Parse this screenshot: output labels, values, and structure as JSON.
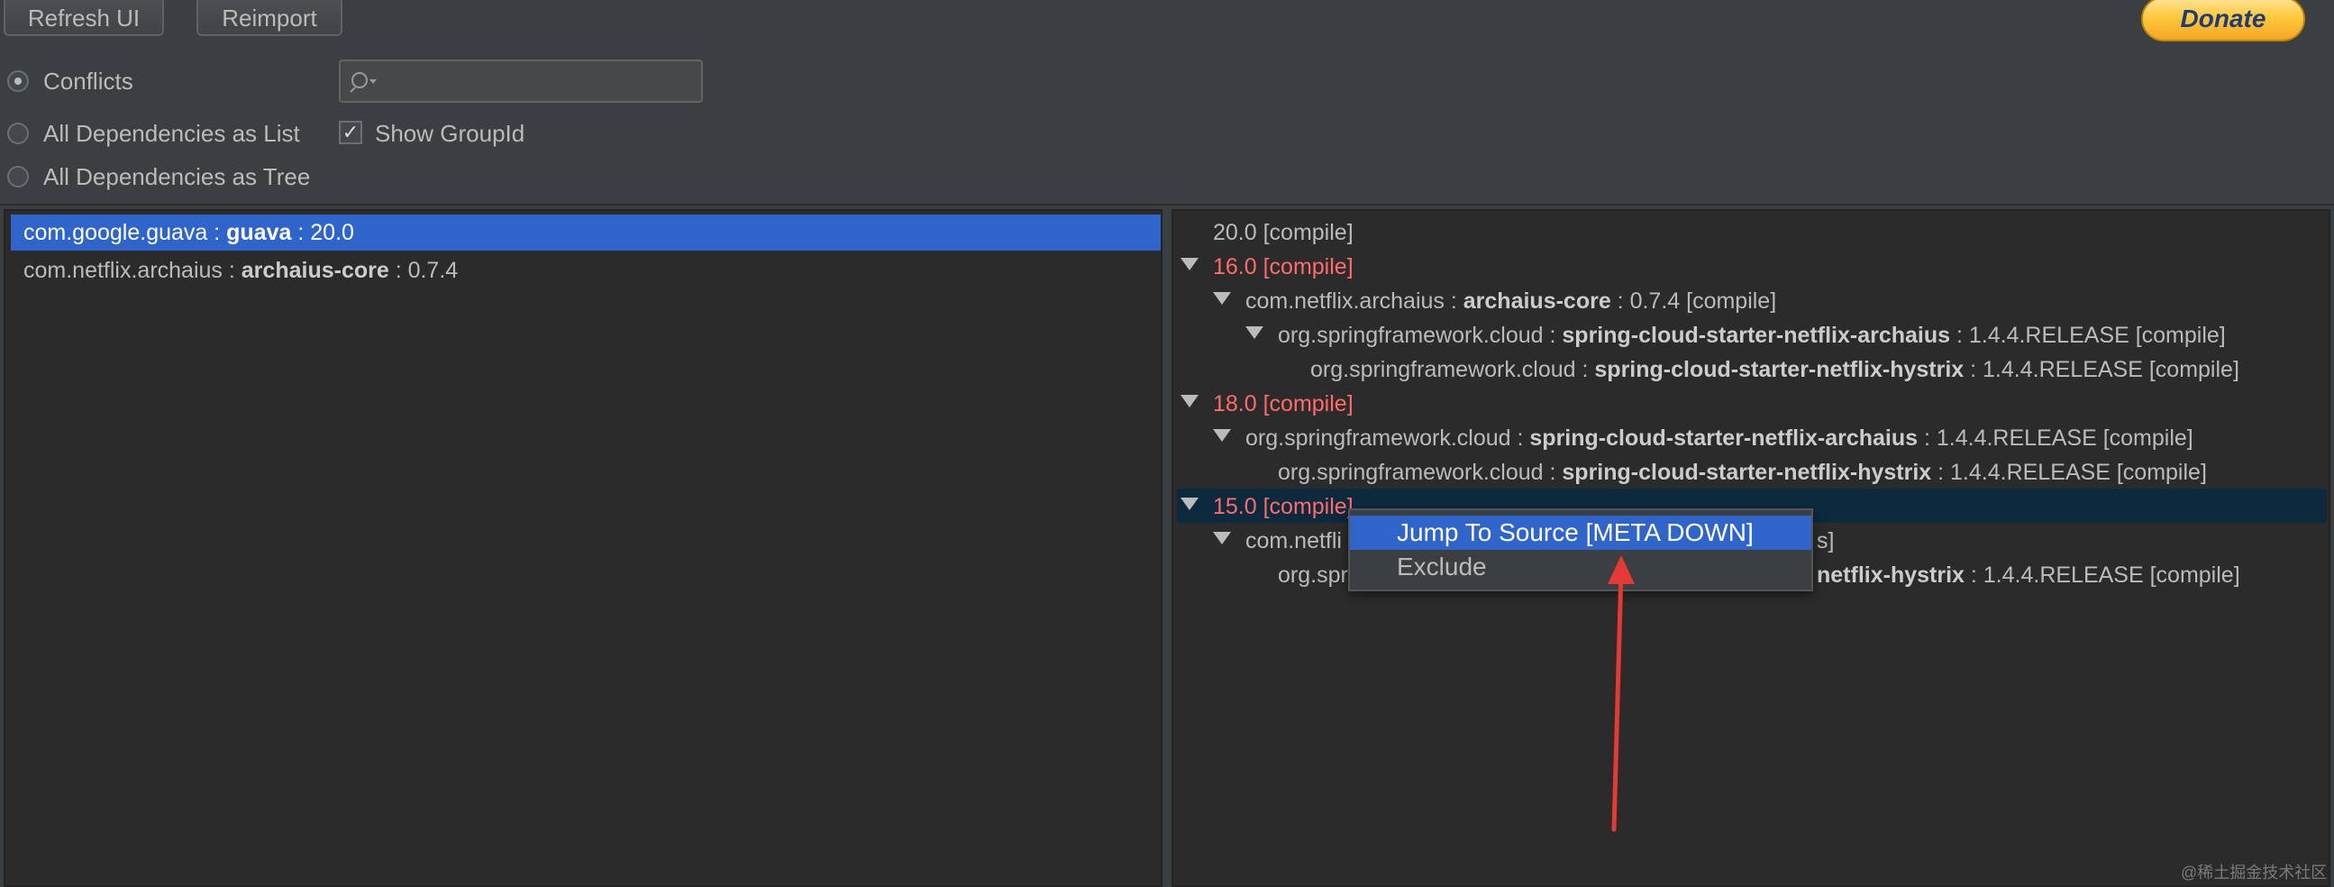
{
  "toolbar": {
    "refresh_label": "Refresh UI",
    "reimport_label": "Reimport",
    "donate_label": "Donate"
  },
  "options": {
    "conflicts": "Conflicts",
    "all_list": "All Dependencies as List",
    "all_tree": "All Dependencies as Tree",
    "show_groupid": "Show GroupId",
    "selected_mode": "Conflicts",
    "show_groupid_checked": true
  },
  "search": {
    "placeholder": "",
    "value": ""
  },
  "left_list": [
    {
      "group": "com.google.guava",
      "sep": " : ",
      "artifact": "guava",
      "version": " : 20.0"
    },
    {
      "group": "com.netflix.archaius",
      "sep": " : ",
      "artifact": "archaius-core",
      "version": " : 0.7.4"
    }
  ],
  "tree": {
    "r0": "20.0 [compile]",
    "r1": "16.0 [compile]",
    "r2_g": "com.netflix.archaius : ",
    "r2_a": "archaius-core",
    "r2_v": " : 0.7.4 [compile]",
    "r3_g": "org.springframework.cloud : ",
    "r3_a": "spring-cloud-starter-netflix-archaius",
    "r3_v": " : 1.4.4.RELEASE [compile]",
    "r4_g": "org.springframework.cloud : ",
    "r4_a": "spring-cloud-starter-netflix-hystrix",
    "r4_v": " : 1.4.4.RELEASE [compile]",
    "r5": "18.0 [compile]",
    "r6_g": "org.springframework.cloud : ",
    "r6_a": "spring-cloud-starter-netflix-archaius",
    "r6_v": " : 1.4.4.RELEASE [compile]",
    "r7_g": "org.springframework.cloud : ",
    "r7_a": "spring-cloud-starter-netflix-hystrix",
    "r7_v": " : 1.4.4.RELEASE [compile]",
    "r8": "15.0 [compile]",
    "r9_visible": "com.netfli",
    "r9_tail": "s]",
    "r10_visible": "org.spr",
    "r10_a": "netflix-hystrix",
    "r10_v": " : 1.4.4.RELEASE [compile]"
  },
  "context_menu": {
    "item1": "Jump To Source [META DOWN]",
    "item2": "Exclude"
  },
  "watermark": "@稀土掘金技术社区",
  "colors": {
    "accent": "#2f65ca",
    "conflict": "#ff6b68",
    "arrow": "#e53935"
  }
}
